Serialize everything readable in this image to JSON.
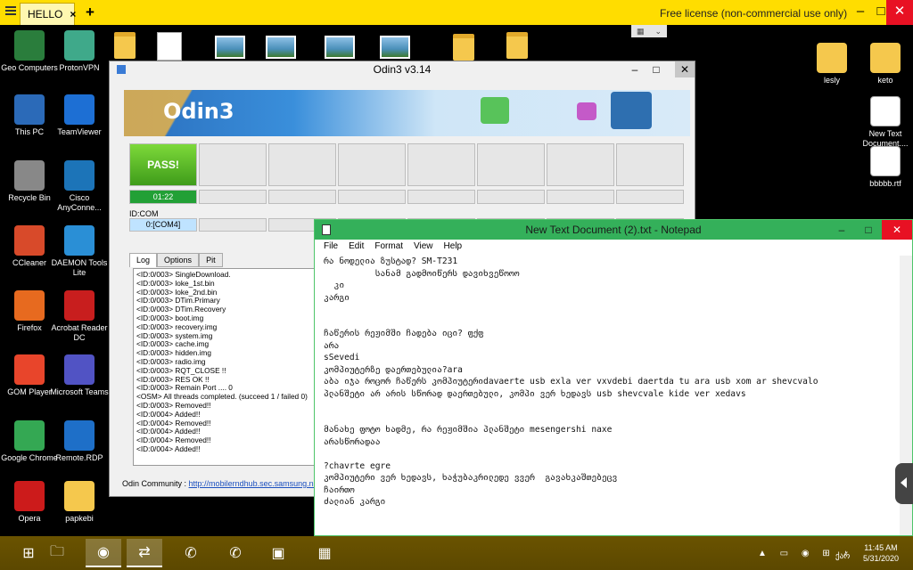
{
  "remote": {
    "tab_label": "HELLO",
    "tab_close": "×",
    "new_tab": "+",
    "license": "Free license (non-commercial use only)",
    "minimize": "–",
    "maximize": "□",
    "close": "✕"
  },
  "desktop_left": [
    {
      "label": "Geo Computers",
      "icon": "user-folder-icon"
    },
    {
      "label": "ProtonVPN",
      "icon": "protonvpn-icon"
    },
    {
      "label": "This PC",
      "icon": "computer-icon"
    },
    {
      "label": "TeamViewer",
      "icon": "teamviewer-icon"
    },
    {
      "label": "Recycle Bin",
      "icon": "recycle-bin-icon"
    },
    {
      "label": "Cisco AnyConne...",
      "icon": "cisco-icon"
    },
    {
      "label": "CCleaner",
      "icon": "ccleaner-icon"
    },
    {
      "label": "DAEMON Tools Lite",
      "icon": "daemon-tools-icon"
    },
    {
      "label": "Firefox",
      "icon": "firefox-icon"
    },
    {
      "label": "Acrobat Reader DC",
      "icon": "acrobat-icon"
    },
    {
      "label": "GOM Player",
      "icon": "gom-player-icon"
    },
    {
      "label": "Microsoft Teams",
      "icon": "teams-icon"
    },
    {
      "label": "Google Chrome",
      "icon": "chrome-icon"
    },
    {
      "label": "Remote.RDP",
      "icon": "remote-rdp-icon"
    },
    {
      "label": "Opera",
      "icon": "opera-icon"
    },
    {
      "label": "papkebi",
      "icon": "folder-icon"
    }
  ],
  "desktop_right": [
    {
      "label": "lesly",
      "icon": "folder-icon"
    },
    {
      "label": "keto",
      "icon": "folder-icon"
    },
    {
      "label": "New Text Document....",
      "icon": "text-document-icon"
    },
    {
      "label": "bbbbb.rtf",
      "icon": "word-document-icon"
    }
  ],
  "odin": {
    "title": "Odin3 v3.14",
    "logo": "Odin3",
    "pass": "PASS!",
    "time": "01:22",
    "id_com_label": "ID:COM",
    "com_port": "0:[COM4]",
    "tabs": [
      "Log",
      "Options",
      "Pit"
    ],
    "log": [
      "<ID:0/003> SingleDownload.",
      "<ID:0/003> loke_1st.bin",
      "<ID:0/003> loke_2nd.bin",
      "<ID:0/003> DTim.Primary",
      "<ID:0/003> DTim.Recovery",
      "<ID:0/003> boot.img",
      "<ID:0/003> recovery.img",
      "<ID:0/003> system.img",
      "<ID:0/003> cache.img",
      "<ID:0/003> hidden.img",
      "<ID:0/003> radio.img",
      "<ID:0/003> RQT_CLOSE !!",
      "<ID:0/003> RES OK !!",
      "<ID:0/003> Remain Port .... 0",
      "<OSM> All threads completed. (succeed 1 / failed 0)",
      "<ID:0/003> Removed!!",
      "<ID:0/004> Added!!",
      "<ID:0/004> Removed!!",
      "<ID:0/004> Added!!",
      "<ID:0/004> Removed!!",
      "<ID:0/004> Added!!"
    ],
    "community_label": "Odin Community :",
    "community_link": "http://mobilerndhub.sec.samsung.net/hub"
  },
  "notepad": {
    "title": "New Text Document (2).txt - Notepad",
    "menu": [
      "File",
      "Edit",
      "Format",
      "View",
      "Help"
    ],
    "text": "რა ნოდელია ზუსტად? SM-T231\n          სანამ გადმოიწერს დავიხვეწოოო\n  კი\nკარგი\n\n\nჩაწერის რეჟიმში ჩადება იცი? ფქფ\nარა\nsSevedi\nკომპიუტერზე დაერთებულია?ara\nაბა იჯა როცორ ჩაწერს კომპიუტერიdavaerte usb exla ver vxvdebi daertda tu ara usb xom ar shevcvalo\nპლანშეტი არ არის სწორად დაერთებული, კომპი ვერ ხედავს usb shevcvale kide ver xedavs\n\n\nმანახე ფოტო ხადმე, რა რეჟიმშია პლანშეტი mesengershi naxe\nარასწორადაა\n\n?chavrte egre\nკომპიუტერი ვერ ხედავს, ხაჭუბაკრილედე ვვერ  გავახკაშთებეცვ\nჩაირთო\nძალიან კარგი"
  },
  "taskbar": {
    "items": [
      "start-icon",
      "file-explorer-icon",
      "chrome-icon",
      "teamviewer-icon",
      "whatsapp-icon",
      "viber-icon",
      "remote-desktop-icon",
      "calculator-icon"
    ],
    "language": "ქარ",
    "time": "11:45 AM",
    "date": "5/31/2020"
  },
  "colors": {
    "remote_bar": "#ffdd00",
    "pass_green": "#3f9c1a",
    "notepad_title": "#34b05a",
    "close_red": "#e81123"
  }
}
